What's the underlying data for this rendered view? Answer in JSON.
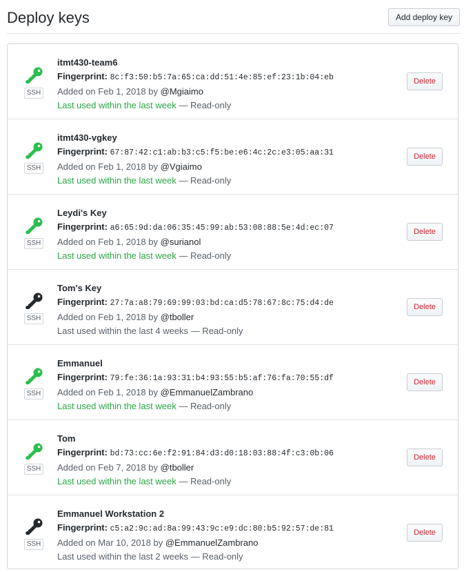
{
  "header": {
    "title": "Deploy keys",
    "add_button": "Add deploy key"
  },
  "colors": {
    "recent_key": "#2cbe4e",
    "stale_key": "#24292e",
    "recent_text": "#28a745"
  },
  "keys": [
    {
      "name": "itmt430-team6",
      "fingerprint_label": "Fingerprint:",
      "fingerprint": "8c:f3:50:b5:7a:65:ca:dd:51:4e:85:ef:23:1b:04:eb",
      "added_prefix": "Added on Feb 1, 2018 by",
      "user": "@Mgiaimo",
      "last_used": "Last used within the last week",
      "access": "— Read-only",
      "recent": true,
      "badge": "SSH",
      "delete_label": "Delete",
      "icon": "key-icon"
    },
    {
      "name": "itmt430-vgkey",
      "fingerprint_label": "Fingerprint:",
      "fingerprint": "67:87:42:c1:ab:b3:c5:f5:be:e6:4c:2c:e3:05:aa:31",
      "added_prefix": "Added on Feb 1, 2018 by",
      "user": "@Vgiaimo",
      "last_used": "Last used within the last week",
      "access": "— Read-only",
      "recent": true,
      "badge": "SSH",
      "delete_label": "Delete",
      "icon": "key-icon"
    },
    {
      "name": "Leydi's Key",
      "fingerprint_label": "Fingerprint:",
      "fingerprint": "a6:65:9d:da:06:35:45:99:ab:53:08:88:5e:4d:ec:07",
      "added_prefix": "Added on Feb 1, 2018 by",
      "user": "@surianol",
      "last_used": "Last used within the last week",
      "access": "— Read-only",
      "recent": true,
      "badge": "SSH",
      "delete_label": "Delete",
      "icon": "key-icon"
    },
    {
      "name": "Tom's Key",
      "fingerprint_label": "Fingerprint:",
      "fingerprint": "27:7a:a8:79:69:99:03:bd:ca:d5:78:67:8c:75:d4:de",
      "added_prefix": "Added on Feb 1, 2018 by",
      "user": "@tboller",
      "last_used": "Last used within the last 4 weeks",
      "access": "— Read-only",
      "recent": false,
      "badge": "SSH",
      "delete_label": "Delete",
      "icon": "key-icon"
    },
    {
      "name": "Emmanuel",
      "fingerprint_label": "Fingerprint:",
      "fingerprint": "79:fe:36:1a:93:31:b4:93:55:b5:af:76:fa:70:55:df",
      "added_prefix": "Added on Feb 1, 2018 by",
      "user": "@EmmanuelZambrano",
      "last_used": "Last used within the last week",
      "access": "— Read-only",
      "recent": true,
      "badge": "SSH",
      "delete_label": "Delete",
      "icon": "key-icon"
    },
    {
      "name": "Tom",
      "fingerprint_label": "Fingerprint:",
      "fingerprint": "bd:73:cc:6e:f2:91:84:d3:d0:18:03:88:4f:c3:0b:06",
      "added_prefix": "Added on Feb 7, 2018 by",
      "user": "@tboller",
      "last_used": "Last used within the last week",
      "access": "— Read-only",
      "recent": true,
      "badge": "SSH",
      "delete_label": "Delete",
      "icon": "key-icon"
    },
    {
      "name": "Emmanuel Workstation 2",
      "fingerprint_label": "Fingerprint:",
      "fingerprint": "c5:a2:9c:ad:8a:99:43:9c:e9:dc:80:b5:92:57:de:81",
      "added_prefix": "Added on Mar 10, 2018 by",
      "user": "@EmmanuelZambrano",
      "last_used": "Last used within the last 2 weeks",
      "access": "— Read-only",
      "recent": false,
      "badge": "SSH",
      "delete_label": "Delete",
      "icon": "key-icon"
    }
  ]
}
